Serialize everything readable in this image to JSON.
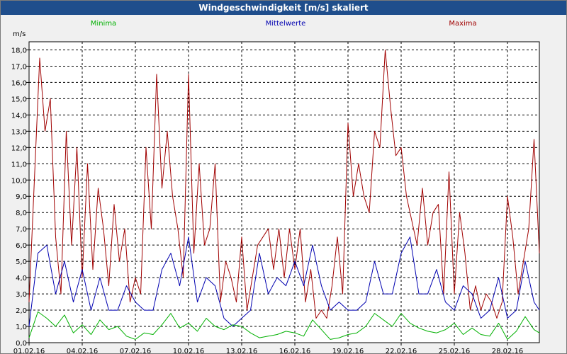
{
  "window": {
    "title": "Windgeschwindigkeit [m/s] skaliert"
  },
  "chart_data": {
    "type": "line",
    "title": "Windgeschwindigkeit [m/s] skaliert",
    "ylabel": "m/s",
    "xlabel": "",
    "ylim": [
      0,
      18.5
    ],
    "xlim_days": [
      1,
      29.8
    ],
    "grid": true,
    "legend_placement": "top",
    "y_ticks": [
      "0,0",
      "1,0",
      "2,0",
      "3,0",
      "4,0",
      "5,0",
      "6,0",
      "7,0",
      "8,0",
      "9,0",
      "10,0",
      "11,0",
      "12,0",
      "13,0",
      "14,0",
      "15,0",
      "16,0",
      "17,0",
      "18,0"
    ],
    "x_ticks": [
      "01.02.16",
      "04.02.16",
      "07.02.16",
      "10.02.16",
      "13.02.16",
      "16.02.16",
      "19.02.16",
      "22.02.16",
      "25.02.16",
      "28.02.16"
    ],
    "x_tick_days": [
      1,
      4,
      7,
      10,
      13,
      16,
      19,
      22,
      25,
      28
    ],
    "series": [
      {
        "name": "Minima",
        "color": "#00b000",
        "x": [
          1.0,
          1.5,
          2.0,
          2.5,
          3.0,
          3.5,
          4.0,
          4.5,
          5.0,
          5.5,
          6.0,
          6.5,
          7.0,
          7.5,
          8.0,
          8.5,
          9.0,
          9.5,
          10.0,
          10.5,
          11.0,
          11.5,
          12.0,
          12.5,
          13.0,
          13.5,
          14.0,
          14.5,
          15.0,
          15.5,
          16.0,
          16.5,
          17.0,
          17.5,
          18.0,
          18.5,
          19.0,
          19.5,
          20.0,
          20.5,
          21.0,
          21.5,
          22.0,
          22.5,
          23.0,
          23.5,
          24.0,
          24.5,
          25.0,
          25.5,
          26.0,
          26.5,
          27.0,
          27.5,
          28.0,
          28.5,
          29.0,
          29.5,
          29.8
        ],
        "values": [
          0.3,
          1.9,
          1.5,
          1.0,
          1.7,
          0.6,
          1.1,
          0.5,
          1.4,
          0.8,
          1.0,
          0.4,
          0.2,
          0.6,
          0.5,
          1.1,
          1.8,
          0.9,
          1.2,
          0.7,
          1.5,
          1.0,
          0.8,
          1.1,
          1.0,
          0.6,
          0.3,
          0.4,
          0.5,
          0.7,
          0.6,
          0.4,
          1.4,
          0.8,
          0.2,
          0.3,
          0.5,
          0.6,
          1.0,
          1.8,
          1.4,
          1.0,
          1.8,
          1.2,
          0.9,
          0.7,
          0.6,
          0.8,
          1.2,
          0.5,
          0.9,
          0.5,
          0.4,
          1.2,
          0.2,
          0.7,
          1.6,
          0.8,
          0.6
        ]
      },
      {
        "name": "Mittelwerte",
        "color": "#0000b0",
        "x": [
          1.0,
          1.5,
          2.0,
          2.5,
          3.0,
          3.5,
          4.0,
          4.5,
          5.0,
          5.5,
          6.0,
          6.5,
          7.0,
          7.5,
          8.0,
          8.5,
          9.0,
          9.5,
          10.0,
          10.5,
          11.0,
          11.5,
          12.0,
          12.5,
          13.0,
          13.5,
          14.0,
          14.5,
          15.0,
          15.5,
          16.0,
          16.5,
          17.0,
          17.5,
          18.0,
          18.5,
          19.0,
          19.5,
          20.0,
          20.5,
          21.0,
          21.5,
          22.0,
          22.5,
          23.0,
          23.5,
          24.0,
          24.5,
          25.0,
          25.5,
          26.0,
          26.5,
          27.0,
          27.5,
          28.0,
          28.5,
          29.0,
          29.5,
          29.8
        ],
        "values": [
          1.0,
          5.5,
          6.0,
          3.0,
          5.0,
          2.5,
          4.5,
          2.0,
          4.0,
          2.0,
          2.0,
          3.5,
          2.5,
          2.0,
          2.0,
          4.5,
          5.5,
          3.5,
          6.5,
          2.5,
          4.0,
          3.5,
          1.5,
          1.0,
          1.5,
          2.0,
          5.5,
          3.0,
          4.0,
          3.5,
          5.0,
          3.5,
          6.0,
          3.5,
          2.0,
          2.5,
          2.0,
          2.0,
          2.5,
          5.0,
          3.0,
          3.0,
          5.5,
          6.5,
          3.0,
          3.0,
          4.5,
          2.5,
          2.0,
          3.5,
          3.0,
          1.5,
          2.0,
          4.0,
          1.5,
          2.0,
          5.0,
          2.5,
          2.0
        ]
      },
      {
        "name": "Maxima",
        "color": "#a00000",
        "x": [
          1.0,
          1.3,
          1.6,
          1.9,
          2.2,
          2.5,
          2.8,
          3.1,
          3.4,
          3.7,
          4.0,
          4.3,
          4.6,
          4.9,
          5.2,
          5.5,
          5.8,
          6.1,
          6.4,
          6.7,
          7.0,
          7.3,
          7.6,
          7.9,
          8.2,
          8.5,
          8.8,
          9.1,
          9.4,
          9.7,
          10.0,
          10.3,
          10.6,
          10.9,
          11.2,
          11.5,
          11.8,
          12.1,
          12.4,
          12.7,
          13.0,
          13.3,
          13.6,
          13.9,
          14.2,
          14.5,
          14.8,
          15.1,
          15.4,
          15.7,
          16.0,
          16.3,
          16.6,
          16.9,
          17.2,
          17.5,
          17.8,
          18.1,
          18.4,
          18.7,
          19.0,
          19.3,
          19.6,
          19.9,
          20.2,
          20.5,
          20.8,
          21.1,
          21.4,
          21.7,
          22.0,
          22.3,
          22.6,
          22.9,
          23.2,
          23.5,
          23.8,
          24.1,
          24.4,
          24.7,
          25.0,
          25.3,
          25.6,
          25.9,
          26.2,
          26.5,
          26.8,
          27.1,
          27.4,
          27.7,
          28.0,
          28.3,
          28.6,
          28.9,
          29.2,
          29.5,
          29.8
        ],
        "values": [
          2.5,
          10.0,
          17.5,
          13.0,
          15.0,
          6.5,
          3.0,
          13.0,
          6.0,
          12.0,
          4.0,
          11.0,
          4.5,
          9.5,
          7.0,
          3.5,
          8.5,
          5.0,
          7.0,
          2.5,
          4.0,
          3.0,
          12.0,
          7.0,
          16.5,
          9.5,
          13.0,
          9.0,
          7.0,
          4.0,
          16.5,
          5.5,
          11.0,
          6.0,
          7.0,
          11.0,
          2.5,
          5.0,
          4.0,
          2.5,
          6.5,
          2.0,
          4.0,
          6.0,
          6.5,
          7.0,
          4.5,
          7.0,
          4.0,
          7.0,
          4.5,
          7.0,
          2.5,
          4.5,
          1.5,
          2.0,
          1.5,
          3.5,
          6.5,
          3.0,
          13.5,
          9.0,
          11.0,
          9.0,
          8.0,
          13.0,
          12.0,
          18.0,
          14.5,
          11.5,
          12.0,
          9.0,
          7.5,
          6.0,
          9.5,
          6.0,
          8.0,
          8.5,
          3.0,
          10.5,
          3.0,
          8.0,
          5.5,
          2.0,
          3.5,
          2.0,
          3.0,
          2.5,
          1.5,
          2.5,
          9.0,
          6.5,
          3.0,
          5.0,
          7.0,
          12.5,
          5.5
        ]
      }
    ]
  }
}
